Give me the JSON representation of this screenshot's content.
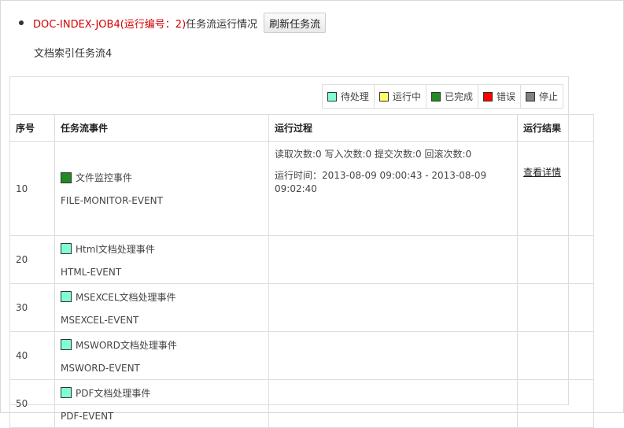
{
  "header": {
    "job_id": "DOC-INDEX-JOB4(运行编号：2)",
    "job_suffix": "任务流运行情况",
    "refresh_button": "刷新任务流",
    "subtitle": "文档索引任务流4"
  },
  "legend": [
    {
      "label": "待处理",
      "color": "#7fffd4",
      "icon": "pending-swatch-icon"
    },
    {
      "label": "运行中",
      "color": "#ffff66",
      "icon": "running-swatch-icon"
    },
    {
      "label": "已完成",
      "color": "#228b22",
      "icon": "completed-swatch-icon"
    },
    {
      "label": "错误",
      "color": "#ff0000",
      "icon": "error-swatch-icon"
    },
    {
      "label": "停止",
      "color": "#808080",
      "icon": "stopped-swatch-icon"
    }
  ],
  "table": {
    "headers": [
      "序号",
      "任务流事件",
      "运行过程",
      "运行结果"
    ],
    "rows": [
      {
        "seq": "10",
        "event_name": "文件监控事件",
        "event_code": "FILE-MONITOR-EVENT",
        "status_color": "#228b22",
        "process_counts": "读取次数:0 写入次数:0 提交次数:0 回滚次数:0",
        "process_time": "运行时间：2013-08-09 09:00:43 - 2013-08-09 09:02:40",
        "result_link": "查看详情"
      },
      {
        "seq": "20",
        "event_name": "Html文档处理事件",
        "event_code": "HTML-EVENT",
        "status_color": "#7fffd4"
      },
      {
        "seq": "30",
        "event_name": "MSEXCEL文档处理事件",
        "event_code": "MSEXCEL-EVENT",
        "status_color": "#7fffd4"
      },
      {
        "seq": "40",
        "event_name": "MSWORD文档处理事件",
        "event_code": "MSWORD-EVENT",
        "status_color": "#7fffd4"
      },
      {
        "seq": "50",
        "event_name": "PDF文档处理事件",
        "event_code": "PDF-EVENT",
        "status_color": "#7fffd4"
      }
    ]
  }
}
